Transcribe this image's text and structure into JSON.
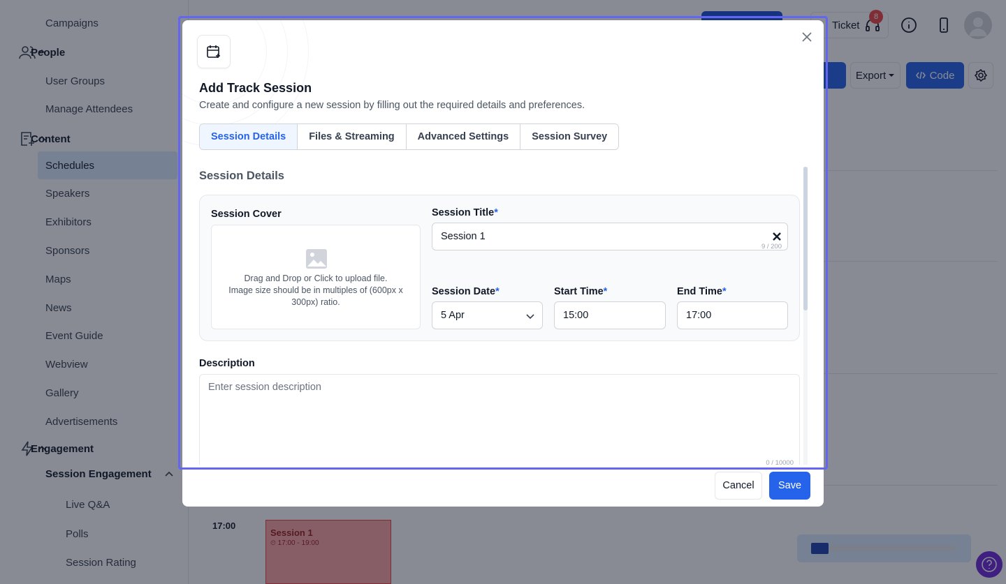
{
  "sidebar": {
    "items": [
      "Campaigns",
      "User Groups",
      "Manage Attendees",
      "Schedules",
      "Speakers",
      "Exhibitors",
      "Sponsors",
      "Maps",
      "News",
      "Event Guide",
      "Webview",
      "Gallery",
      "Advertisements"
    ],
    "sections": {
      "people": "People",
      "content": "Content",
      "engagement": "Engagement"
    },
    "engagement_group": "Session Engagement",
    "engagement_items": [
      "Live Q&A",
      "Polls",
      "Session Rating"
    ]
  },
  "topbar": {
    "ticket_label": "Ticket",
    "ticket_badge": "8"
  },
  "toolbar": {
    "export_label": "Export",
    "code_label": "Code"
  },
  "schedule": {
    "time_label": "17:00",
    "session_title": "Session 1",
    "session_time": "17:00 - 19:00"
  },
  "progress": {
    "fraction": 0.12
  },
  "modal": {
    "title": "Add Track Session",
    "subtitle": "Create and configure a new session by filling out the required details and preferences.",
    "tabs": [
      "Session Details",
      "Files & Streaming",
      "Advanced Settings",
      "Session Survey"
    ],
    "active_tab": "Session Details",
    "section_title": "Session Details",
    "cover_label": "Session Cover",
    "upload_line1": "Drag and Drop or Click to upload file.",
    "upload_line2": "Image size should be in multiples of (600px x 300px) ratio.",
    "title_label": "Session Title",
    "title_value": "Session 1",
    "title_counter": "9 / 200",
    "date_label": "Session Date",
    "date_value": "5 Apr",
    "start_label": "Start Time",
    "start_value": "15:00",
    "end_label": "End Time",
    "end_value": "17:00",
    "required_mark": "*",
    "description_label": "Description",
    "description_placeholder": "Enter session description",
    "description_counter": "0 / 10000",
    "cancel_label": "Cancel",
    "save_label": "Save"
  },
  "colors": {
    "primary": "#2563eb",
    "focus_ring": "#6366f1",
    "badge": "#ef4444",
    "session_card": "#fca5a5"
  }
}
